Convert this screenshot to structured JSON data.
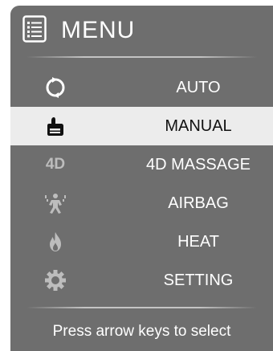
{
  "header": {
    "title": "MENU",
    "icon": "list-menu-icon"
  },
  "menu": {
    "items": [
      {
        "label": "AUTO",
        "icon": "cycle-arrows-icon",
        "selected": false
      },
      {
        "label": "MANUAL",
        "icon": "hand-thumb-icon",
        "selected": true
      },
      {
        "label": "4D MASSAGE",
        "icon_text": "4D",
        "icon": "4d-icon",
        "selected": false
      },
      {
        "label": "AIRBAG",
        "icon": "airbag-person-icon",
        "selected": false
      },
      {
        "label": "HEAT",
        "icon": "flame-icon",
        "selected": false
      },
      {
        "label": "SETTING",
        "icon": "gear-icon",
        "selected": false
      }
    ]
  },
  "footer": {
    "hint": "Press arrow keys to select"
  },
  "colors": {
    "panel": "#6e6e6e",
    "selected_bg": "#ececec",
    "text": "#ffffff",
    "icon_inactive": "#bdbdbd"
  }
}
